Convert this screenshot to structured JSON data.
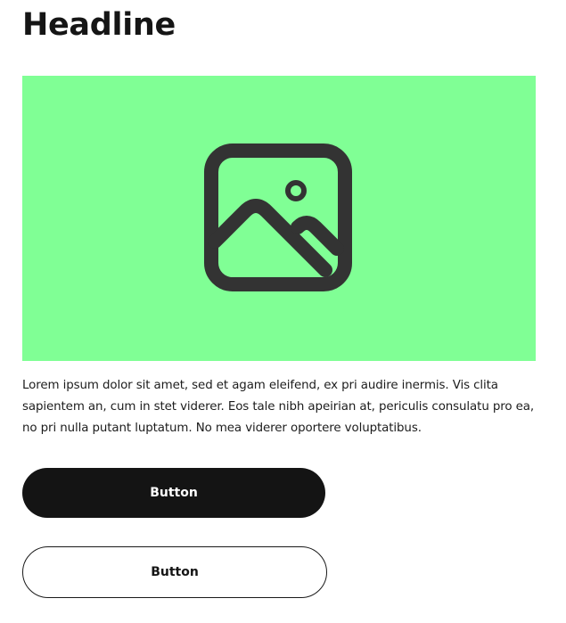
{
  "headline": "Headline",
  "hero": {
    "background_color": "#80ff95",
    "icon": "image-placeholder-icon",
    "icon_color": "#333333"
  },
  "body_text": "Lorem ipsum dolor sit amet, sed et agam eleifend, ex pri audire inermis. Vis clita sapientem an, cum in stet viderer. Eos tale nibh apeirian at, periculis consulatu pro ea, no pri nulla putant luptatum. No mea viderer oportere voluptatibus.",
  "buttons": {
    "primary_label": "Button",
    "secondary_label": "Button"
  }
}
